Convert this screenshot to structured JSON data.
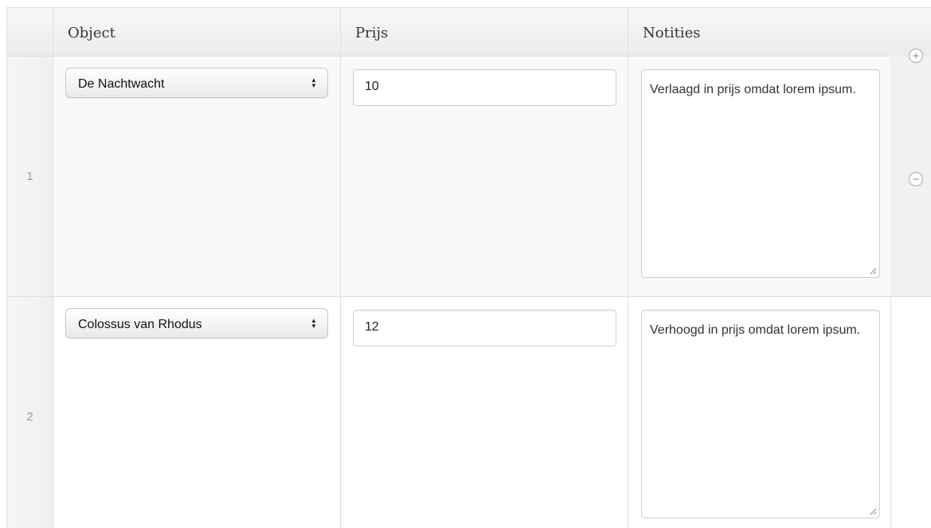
{
  "table": {
    "headers": {
      "number": "",
      "object": "Object",
      "price": "Prijs",
      "notes": "Notities"
    },
    "rows": [
      {
        "number": "1",
        "object": "De Nachtwacht",
        "price": "10",
        "notes": "Verlaagd in prijs omdat lorem ipsum."
      },
      {
        "number": "2",
        "object": "Colossus van Rhodus",
        "price": "12",
        "notes": "Verhoogd in prijs omdat lorem ipsum."
      }
    ]
  },
  "controls": {
    "add_icon": "plus-circle-icon",
    "remove_icon": "minus-circle-icon",
    "add_symbol": "+",
    "remove_symbol": "−"
  }
}
